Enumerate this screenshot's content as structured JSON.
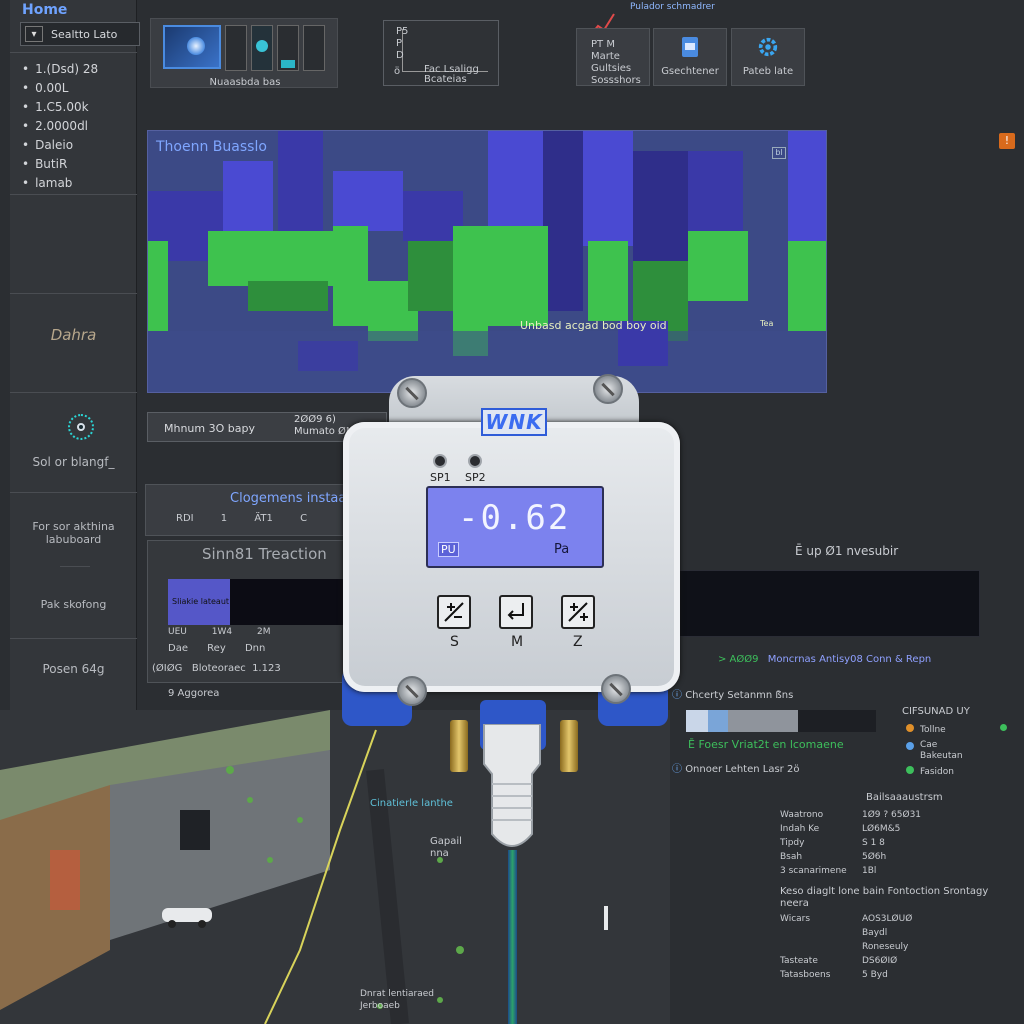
{
  "sidebar": {
    "title": "Home",
    "select_label": "Sealtto Lato",
    "items": [
      "1.(Dsd) 28",
      "0.00L",
      "1.C5.00k",
      "2.0000dl",
      "Daleio",
      "ButiR",
      "lamab"
    ],
    "section_label": "Dahra",
    "knob_label": "Sol or blangf_",
    "info_label": "For sor akthina\nlabuboard",
    "status_label": "Pak skofong",
    "footer_label": "Posen 64g"
  },
  "toolbar": {
    "thumb_label": "Nuaasbda bas",
    "mini_chart_lines": [
      "P5",
      "P",
      "D",
      "ö"
    ],
    "mini_chart_caption": "Fac Lsaligg\nBcateias",
    "top_title": "Pulador schmadrer",
    "card1_lines": [
      "PT M",
      "Marte",
      "Gultsies",
      "Sossshors"
    ],
    "card2_label": "Gsechtener",
    "card3_label": "Pateb late"
  },
  "heatmap": {
    "title": "Thoenn Buasslo",
    "corner": "bl",
    "annotation": "Unbasd acgad bod boy oid",
    "annotation2": "Tea",
    "colors": {
      "background": "#3c4a86",
      "low": "#3a39a8",
      "mid": "#4a4ad2",
      "high": "#3ec24e"
    }
  },
  "status_bar": {
    "left_label": "Mhnum 3O  bapy",
    "right_line1": "2ØØ9 6)",
    "right_line2": "Mumato ØMUD"
  },
  "diagnostics": {
    "title": "Clogemens instaa",
    "row": [
      "RDI",
      "1",
      "ÄT1",
      "C"
    ]
  },
  "transactions": {
    "title": "Sinn81 Treaction",
    "bar_label": "Sliakie lateaut",
    "cells_row1": [
      "UEU",
      "1W4",
      "2M"
    ],
    "cells_row2": [
      "Dae",
      "Rey",
      "Dnn"
    ],
    "row3": "(ØIØG   Bloteoraec  1.123",
    "footer": "9 Aggorea"
  },
  "right_panel": {
    "header": "Ē up Ø1 nvesubir",
    "metric": "Moncrnas Antisy08 Conn & Repn",
    "metric_prefix": "> AØØ9",
    "ident_line": "Chcerty Setanmn ß̈ns",
    "legend_title": "CIFSUNAD UY",
    "legend": [
      {
        "label": "Tollne",
        "color": "#e0902a"
      },
      {
        "label": "Cae\nBakeutan",
        "color": "#5aa0e8"
      },
      {
        "label": "Fasidon",
        "color": "#3dbf5c"
      }
    ],
    "green_title": "Ē Foesr Vriat2t en lcomaene",
    "monitor_line": "Onnoer Lehten Lasr 2ö",
    "spec_heading": "Bailsaaaustrsm",
    "spec_rows": [
      {
        "k": "Waatrono",
        "v": "1Ø9 ? 65Ø31"
      },
      {
        "k": "Indah Ke",
        "v": "LØ6M&5"
      },
      {
        "k": "Tipdy",
        "v": "S 1 8"
      },
      {
        "k": "Bsah",
        "v": "5Ø6h"
      },
      {
        "k": "3 scanarimene",
        "v": "1Bl"
      }
    ],
    "spec_note": "Keso diaglt lone bain Fontoction Srontagy neera",
    "spec_rows2": [
      {
        "k": "Wicars",
        "v": "AOS3LØUØ"
      },
      {
        "k": "",
        "v": "Baydl"
      },
      {
        "k": "",
        "v": "Roneseuly"
      },
      {
        "k": "Tasteate",
        "v": "DS6ØIØ"
      },
      {
        "k": "Tatasboens",
        "v": "5 Byd"
      }
    ]
  },
  "map": {
    "label1": "Cinatierle lanthe",
    "label2": "Gapail\nnna",
    "label3": "Dnrat lentiaraed\nJerboaeb"
  },
  "device": {
    "brand": "WNK",
    "led1": "SP1",
    "led2": "SP2",
    "reading": "-0.62",
    "mode": "PU",
    "unit": "Pa",
    "key1": "S",
    "key2": "M",
    "key3": "Z"
  }
}
